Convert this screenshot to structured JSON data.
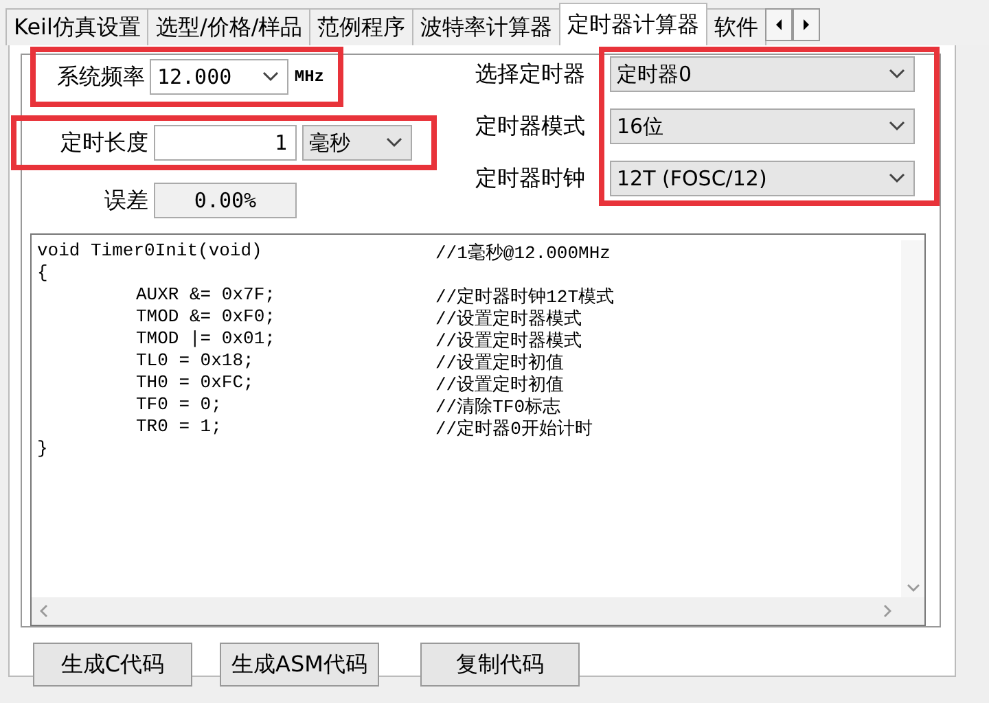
{
  "tabs": [
    {
      "label": "Keil仿真设置",
      "selected": false
    },
    {
      "label": "选型/价格/样品",
      "selected": false
    },
    {
      "label": "范例程序",
      "selected": false
    },
    {
      "label": "波特率计算器",
      "selected": false
    },
    {
      "label": "定时器计算器",
      "selected": true
    },
    {
      "label": "软件",
      "selected": false
    }
  ],
  "frequency": {
    "label": "系统频率",
    "value": "12.000",
    "unit": "MHz"
  },
  "duration": {
    "label": "定时长度",
    "value": "1",
    "unit": "毫秒"
  },
  "error": {
    "label": "误差",
    "value": "0.00%"
  },
  "timer_select": {
    "label": "选择定时器",
    "value": "定时器0"
  },
  "timer_mode": {
    "label": "定时器模式",
    "value": "16位"
  },
  "timer_clock": {
    "label": "定时器时钟",
    "value": "12T (FOSC/12)"
  },
  "code_lines": [
    {
      "code": "void Timer0Init(void)",
      "comment": "//1毫秒@12.000MHz",
      "indented": false
    },
    {
      "code": "{",
      "indented": false
    },
    {
      "code": "AUXR &= 0x7F;",
      "comment": "//定时器时钟12T模式",
      "indented": true
    },
    {
      "code": "TMOD &= 0xF0;",
      "comment": "//设置定时器模式",
      "indented": true
    },
    {
      "code": "TMOD |= 0x01;",
      "comment": "//设置定时器模式",
      "indented": true
    },
    {
      "code": "TL0 = 0x18;",
      "comment": "//设置定时初值",
      "indented": true
    },
    {
      "code": "TH0 = 0xFC;",
      "comment": "//设置定时初值",
      "indented": true
    },
    {
      "code": "TF0 = 0;",
      "comment": "//清除TF0标志",
      "indented": true
    },
    {
      "code": "TR0 = 1;",
      "comment": "//定时器0开始计时",
      "indented": true
    },
    {
      "code": "}",
      "indented": false
    }
  ],
  "buttons": [
    "生成C代码",
    "生成ASM代码",
    "复制代码"
  ]
}
